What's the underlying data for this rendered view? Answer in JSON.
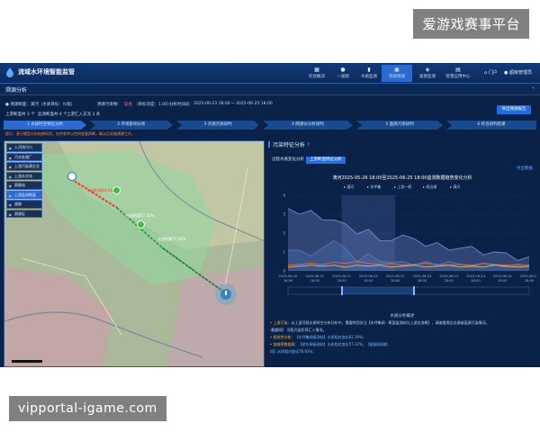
{
  "watermark": {
    "top": "爱游戏赛事平台",
    "bottom": "vipportal-igame.com"
  },
  "header": {
    "app_title": "流域水环境智能监管",
    "nav": [
      {
        "label": "综合概况",
        "icon": "grid-icon"
      },
      {
        "label": "一张图",
        "icon": "person-icon"
      },
      {
        "label": "水质监测",
        "icon": "chart-icon"
      },
      {
        "label": "溯源溯源",
        "icon": "box-icon",
        "active": true
      },
      {
        "label": "遥感监测",
        "icon": "satellite-icon"
      },
      {
        "label": "智慧应用中心",
        "icon": "apps-icon"
      }
    ],
    "home": "门户",
    "user": "超级管理员"
  },
  "page": {
    "title": "溯源分析",
    "collapse": "«"
  },
  "filter": {
    "station": "● 溯源断面：漓河（水质目标：IV类）",
    "pollutant_label": "溯源污染物：",
    "pollutant": "氨氮",
    "pollutant_target": "（目标浓度：1.00）",
    "time_label": "分析时间段：",
    "time_range": "2025-06-23 18:00 ~ 2025-06-25 18:00",
    "upstream": "上游断面共 3 个",
    "outlets": "监测断面共 4 个",
    "tributary": "上游汇入支流 3 条",
    "export_label": "导出溯源报告"
  },
  "steps": [
    "1 水质时空特征分析",
    "2 环境影响分析",
    "3 点源污染研判",
    "4 网源仪分析研判",
    "5 面源污染研判",
    "6 综合研判结果"
  ],
  "hint": "提示：基于模型分析结果研判，仅供参考以空间变量判断，确认后实施溯源工作。",
  "map": {
    "layers": [
      "入河排污口",
      "污水处理厂",
      "上游污染源企业",
      "上游水文站",
      "雨量站",
      "上游监测断面",
      "道路",
      "测源区"
    ],
    "labels": [
      {
        "text": "水质削减84.4%",
        "color": "#ff4040"
      },
      {
        "text": "水质削减57.32%",
        "color": "#ffffff"
      },
      {
        "text": "水质削减77.02%",
        "color": "#ffffff"
      }
    ]
  },
  "panel": {
    "title": "污染特征分析",
    "tabs": [
      "沿程水质变化分析",
      "上游断面特征分析"
    ],
    "link": "导出数据",
    "chart_title": "漓河2025-05-26 18:00至2025-06-25 18:00监测数据趋势变化分析",
    "stations": [
      "漓河",
      "东坪集",
      "上游一桥",
      "桥边湖",
      "漓河"
    ],
    "notes_head": "水质分析概述",
    "notes": [
      {
        "label": "• 上游污染：",
        "text": "从上游河段水质时空分布分析中，需要特别关注【东坪集闸 - 断面监测站与上游支流断】，请查看周边点源或面源污染情况。"
      },
      {
        "label": "",
        "text": "·截据网】 河段污染负荷汇入情况。"
      },
      {
        "label": "• 相关性分析：",
        "text": "【东坪集闸接测站】水质相对变化81.39%；"
      },
      {
        "label": "• 削减率数据表：",
        "text": "【桥东闸接测站】水质相对变化57.32%，【截据网间距"
      },
      {
        "label": "",
        "text": "间】水质相对变化78.93%；"
      }
    ]
  },
  "chart_data": {
    "type": "area",
    "title": "漓河2025-05-26 18:00至2025-06-25 18:00监测数据趋势变化分析",
    "x": [
      "2025-06-20 18:00",
      "2025-06-21 18:00",
      "2025-06-21 18:00",
      "2025-06-22 18:00",
      "2025-06-22 18:00",
      "2025-06-23 18:00",
      "2025-06-23 18:00",
      "2025-06-24 18:00",
      "2025-06-24 18:00",
      "2025-06-25 18:00"
    ],
    "ylim": [
      0,
      4
    ],
    "yticks": [
      0,
      1,
      2,
      3,
      4
    ],
    "series": [
      {
        "color": "#7a86c8",
        "values": [
          3.3,
          3.0,
          3.2,
          2.7,
          2.7,
          2.5,
          1.95,
          2.2,
          1.6,
          1.6,
          1.9,
          1.7,
          1.3,
          1.5,
          1.1,
          1.2,
          1.3,
          0.85,
          1.0,
          0.95,
          0.55,
          0.75
        ]
      },
      {
        "color": "#4f79b8",
        "values": [
          1.1,
          1.1,
          0.8,
          1.2,
          1.6,
          1.2,
          0.5,
          0.9,
          0.5,
          0.45,
          0.5,
          0.3,
          0.5,
          0.3,
          0.5,
          0.35,
          0.25,
          0.4,
          0.3,
          0.2,
          0.3,
          0.2
        ]
      },
      {
        "color": "#e06a4a",
        "values": [
          0.3,
          0.35,
          0.4,
          0.35,
          0.45,
          0.4,
          0.5,
          0.4,
          0.35,
          0.4,
          0.3,
          0.35,
          0.4,
          0.35,
          0.3,
          0.35,
          0.3,
          0.4,
          0.35,
          0.3,
          0.35,
          0.3
        ]
      },
      {
        "color": "#e3b45a",
        "values": [
          0.2,
          0.25,
          0.3,
          0.25,
          0.3,
          0.2,
          0.3,
          0.25,
          0.3,
          0.2,
          0.25,
          0.3,
          0.2,
          0.25,
          0.3,
          0.2,
          0.25,
          0.2,
          0.3,
          0.25,
          0.2,
          0.25
        ]
      }
    ],
    "highlight_band": [
      2,
      4
    ]
  }
}
